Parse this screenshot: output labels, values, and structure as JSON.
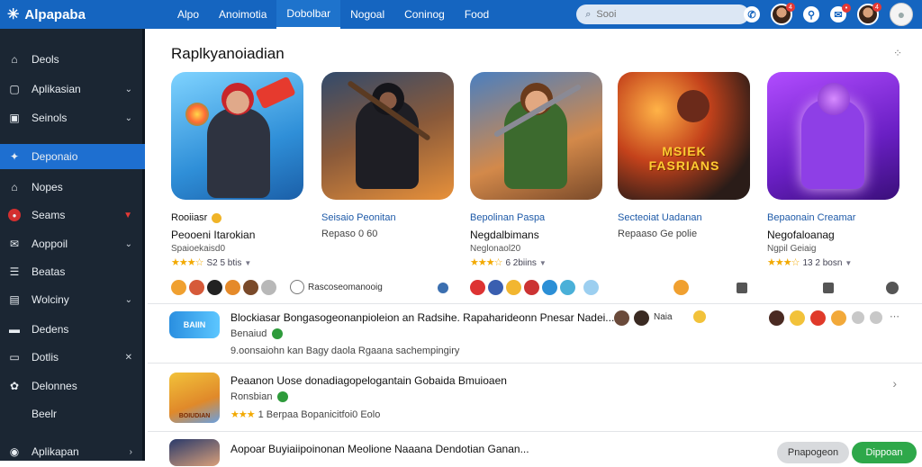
{
  "header": {
    "app_name": "Alpapaba",
    "logo_icon": "asterisk-logo-icon",
    "tabs": [
      "Alpo",
      "Anoimotia",
      "Dobolbar",
      "Nogoal",
      "Coninog",
      "Food"
    ],
    "active_tab": "Dobolbar",
    "search_placeholder": "Sooi",
    "icons": [
      "chat-icon",
      "avatar-notification",
      "search-user-icon",
      "notification-icon",
      "avatar-notification",
      "profile-avatar"
    ],
    "badge_a": "4",
    "badge_b": "4"
  },
  "sidebar": {
    "items": [
      {
        "label": "Deols",
        "icon": "home-icon"
      },
      {
        "label": "Aplikasian",
        "icon": "window-icon"
      },
      {
        "label": "Seinols",
        "icon": "square-icon"
      },
      {
        "label": "Deponaio",
        "icon": "badge-icon"
      },
      {
        "label": "Nopes",
        "icon": "house-icon"
      },
      {
        "label": "Seams",
        "icon": "red-dot-icon"
      },
      {
        "label": "Aoppoil",
        "icon": "mail-icon"
      },
      {
        "label": "Beatas",
        "icon": "list-icon"
      },
      {
        "label": "Wolciny",
        "icon": "book-icon"
      },
      {
        "label": "Dedens",
        "icon": "chat-icon"
      },
      {
        "label": "Dotlis",
        "icon": "tag-icon"
      },
      {
        "label": "Delonnes",
        "icon": "people-icon"
      },
      {
        "label": "Beelr",
        "icon": ""
      },
      {
        "label": "Aplikapan",
        "icon": "person-icon"
      }
    ],
    "active": "Deponaio"
  },
  "section": {
    "title": "Raplkyanoiadian",
    "more_icon": "grid-dots-icon"
  },
  "cards": [
    {
      "name": "Rooiiasr",
      "sub": "Peooeni Itarokian",
      "meta": "Spaioekaisd0",
      "rating": "S2 5 btis",
      "art_text": ""
    },
    {
      "name": "Seisaio Peonitan",
      "sub": "Repaso 0 60",
      "meta": "",
      "rating": "",
      "art_text": ""
    },
    {
      "name": "Bepolinan Paspa",
      "sub": "Negdalbimans",
      "meta": "Neglonaol20",
      "rating": "6 2biins",
      "art_text": ""
    },
    {
      "name": "Secteoiat Uadanan",
      "sub": "Repaaso Ge polie",
      "meta": "",
      "rating": "",
      "art_text": "MSIEK FASRIANS"
    },
    {
      "name": "Bepaonain Creamar",
      "sub": "Negofaloanag",
      "meta": "Ngpil Geiaig",
      "rating": "13 2 bosn",
      "art_text": ""
    }
  ],
  "reaction_label": "Rascoseomanooig",
  "list": [
    {
      "title": "Blockiasar Bongasogeonanpioleion an Radsihe. Rapaharideonn Pnesar Nadei...",
      "sub": "Benaiud",
      "meta": "9.oonsaiohn kan Bagy daola Rgaana sachempingiry",
      "reactor_label": "Naia",
      "thumb_text": "BAIIN"
    },
    {
      "title": "Peaanon Uose donadiagopelogantain Gobaida Bmuioaen",
      "sub": "Ronsbian",
      "meta": "1 Berpaa Bopanicitfoi0 Eolo",
      "reactor_label": "",
      "thumb_text": "BOIUDIAN"
    },
    {
      "title": "Aopoar Buyiaiipoinonan Meolione Naaana Dendotian Ganan...",
      "sub": "",
      "meta": "",
      "reactor_label": "",
      "thumb_text": ""
    }
  ],
  "buttons": {
    "secondary": "Pnapogeon",
    "primary": "Dippoan"
  },
  "colors": {
    "header": "#1565c0",
    "sidebar": "#1b2633",
    "active": "#1e6fd0",
    "primary_button": "#2ea84a"
  }
}
